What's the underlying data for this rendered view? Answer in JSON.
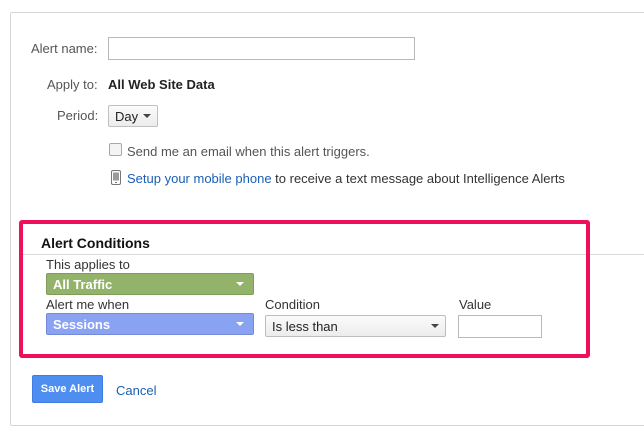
{
  "form": {
    "alert_name_label": "Alert name:",
    "alert_name_value": "",
    "apply_to_label": "Apply to:",
    "apply_to_value": "All Web Site Data",
    "period_label": "Period:",
    "period_value": "Day",
    "email_checkbox_label": "Send me an email when this alert triggers.",
    "email_checked": false,
    "mobile_link": "Setup your mobile phone",
    "mobile_text": " to receive a text message about Intelligence Alerts"
  },
  "conditions": {
    "title": "Alert Conditions",
    "applies_to_label": "This applies to",
    "applies_to_value": "All Traffic",
    "alert_when_label": "Alert me when",
    "alert_when_value": "Sessions",
    "condition_label": "Condition",
    "condition_value": "Is less than",
    "value_label": "Value",
    "value_value": ""
  },
  "actions": {
    "save_label": "Save Alert",
    "cancel_label": "Cancel"
  },
  "colors": {
    "highlight": "#ee0f5d",
    "segment_dropdown": "#93b36a",
    "metric_dropdown": "#8aa2f2",
    "primary_button": "#4d8ef0",
    "link": "#1a5fb4"
  },
  "icons": {
    "phone": "mobile-phone-icon",
    "dropdown": "caret-down-icon"
  }
}
